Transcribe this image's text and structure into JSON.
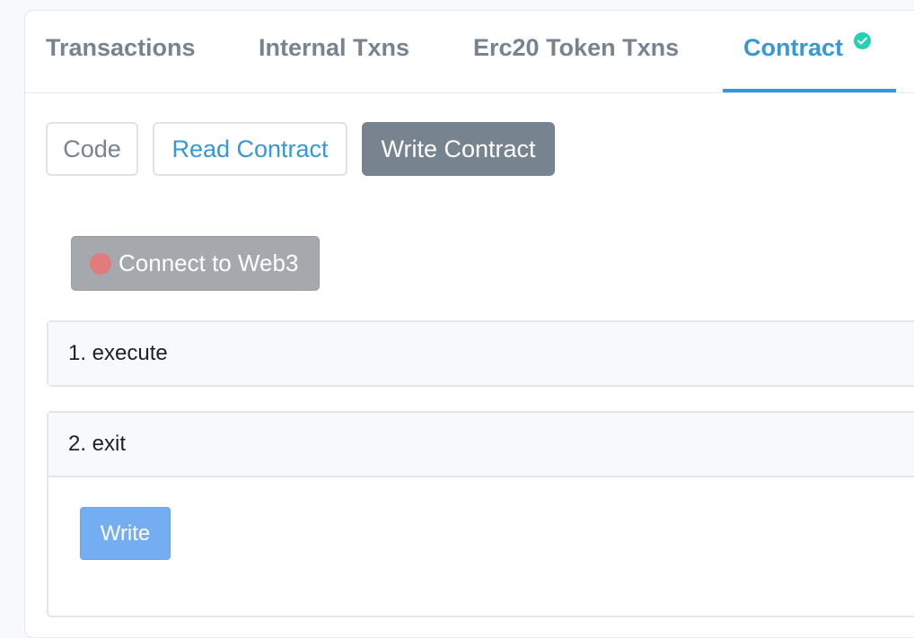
{
  "tabs": [
    {
      "label": "Transactions"
    },
    {
      "label": "Internal Txns"
    },
    {
      "label": "Erc20 Token Txns"
    },
    {
      "label": "Contract"
    }
  ],
  "active_tab": "Contract",
  "sub_buttons": {
    "code": "Code",
    "read": "Read Contract",
    "write": "Write Contract"
  },
  "connect": {
    "label": "Connect to Web3",
    "status_color": "#e27b7b"
  },
  "functions": [
    {
      "title": "1. execute"
    },
    {
      "title": "2. exit",
      "action_label": "Write"
    }
  ],
  "colors": {
    "accent": "#3498db",
    "verified": "#00c9a7",
    "write_button": "#75adf3"
  },
  "icons": {
    "verified": "check-circle-icon",
    "connection_status": "red-dot-icon"
  }
}
